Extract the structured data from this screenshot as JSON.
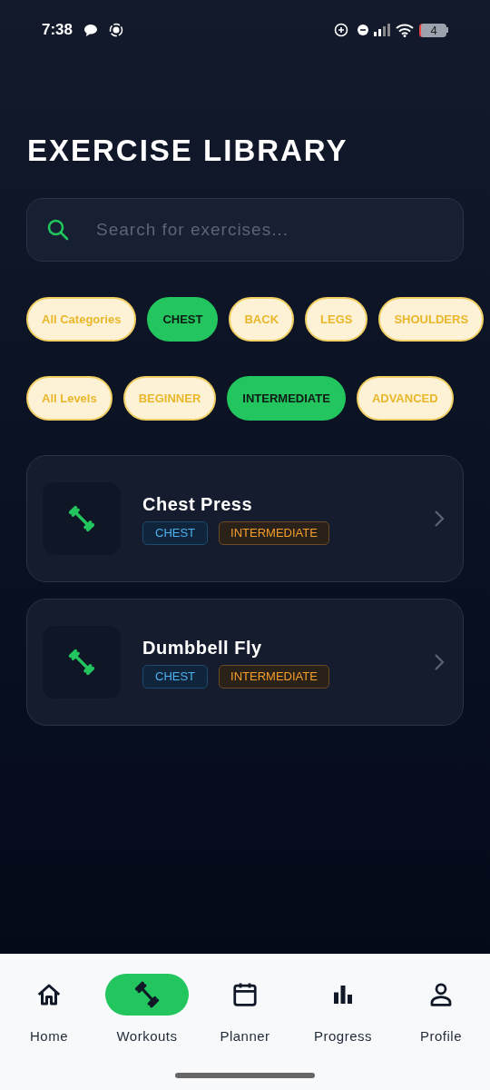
{
  "status_bar": {
    "time": "7:38",
    "battery": "4"
  },
  "title": "EXERCISE LIBRARY",
  "search": {
    "placeholder": "Search for exercises..."
  },
  "category_filters": [
    {
      "label": "All Categories",
      "selected": false
    },
    {
      "label": "CHEST",
      "selected": true
    },
    {
      "label": "BACK",
      "selected": false
    },
    {
      "label": "LEGS",
      "selected": false
    },
    {
      "label": "SHOULDERS",
      "selected": false
    }
  ],
  "level_filters": [
    {
      "label": "All Levels",
      "selected": false
    },
    {
      "label": "BEGINNER",
      "selected": false
    },
    {
      "label": "INTERMEDIATE",
      "selected": true
    },
    {
      "label": "ADVANCED",
      "selected": false
    }
  ],
  "exercises": [
    {
      "name": "Chest Press",
      "category": "CHEST",
      "level": "INTERMEDIATE"
    },
    {
      "name": "Dumbbell Fly",
      "category": "CHEST",
      "level": "INTERMEDIATE"
    }
  ],
  "bottom_nav": [
    {
      "label": "Home",
      "selected": false
    },
    {
      "label": "Workouts",
      "selected": true
    },
    {
      "label": "Planner",
      "selected": false
    },
    {
      "label": "Progress",
      "selected": false
    },
    {
      "label": "Profile",
      "selected": false
    }
  ]
}
